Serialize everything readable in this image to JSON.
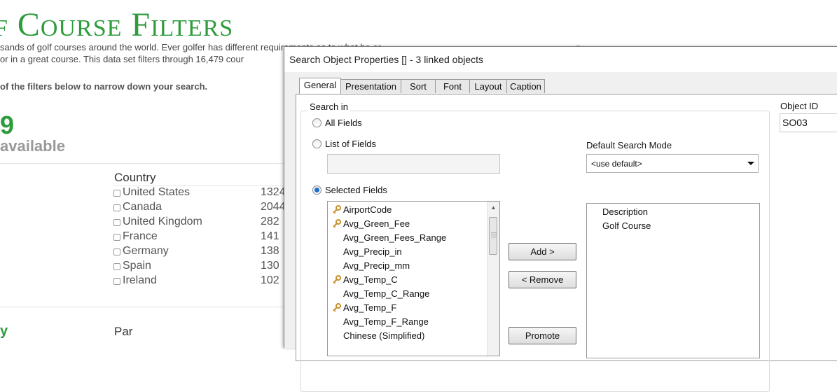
{
  "page": {
    "title": "f Course Filters",
    "intro_lines": [
      "sands of golf courses around the world. Ever golfer has different requirements as to what he or",
      "or in a great course. This data set filters through 16,479 cour"
    ],
    "instruction": " of the filters below to narrow down your search.",
    "count": "9",
    "count_label": "available",
    "country_header": "Country",
    "countries": [
      {
        "name": "United States",
        "count": "1324"
      },
      {
        "name": "Canada",
        "count": "2044"
      },
      {
        "name": "United Kingdom",
        "count": "282"
      },
      {
        "name": "France",
        "count": "141"
      },
      {
        "name": "Germany",
        "count": "138"
      },
      {
        "name": "Spain",
        "count": "130"
      },
      {
        "name": "Ireland",
        "count": "102"
      }
    ],
    "par_header": "Par",
    "left_green_text": "y"
  },
  "dialog": {
    "title": "Search Object Properties [] - 3 linked objects",
    "tabs": [
      "General",
      "Presentation",
      "Sort",
      "Font",
      "Layout",
      "Caption"
    ],
    "active_tab": "General",
    "search_in_label": "Search in",
    "radio_all_fields": "All Fields",
    "radio_list_of_fields": "List of Fields",
    "radio_selected_fields": "Selected Fields",
    "selected_radio": "Selected Fields",
    "list_of_fields_value": "",
    "fields": [
      {
        "name": "AirportCode",
        "key": true
      },
      {
        "name": "Avg_Green_Fee",
        "key": true
      },
      {
        "name": "Avg_Green_Fees_Range",
        "key": false
      },
      {
        "name": "Avg_Precip_in",
        "key": false
      },
      {
        "name": "Avg_Precip_mm",
        "key": false
      },
      {
        "name": "Avg_Temp_C",
        "key": true
      },
      {
        "name": "Avg_Temp_C_Range",
        "key": false
      },
      {
        "name": "Avg_Temp_F",
        "key": true
      },
      {
        "name": "Avg_Temp_F_Range",
        "key": false
      },
      {
        "name": "Chinese (Simplified)",
        "key": false
      }
    ],
    "buttons": {
      "add": "Add >",
      "remove": "< Remove",
      "promote": "Promote"
    },
    "default_search_mode_label": "Default Search Mode",
    "default_search_mode_value": "<use default>",
    "selected_fields": [
      "Description",
      "Golf Course"
    ],
    "object_id_label": "Object ID",
    "object_id_value": "SO03"
  },
  "colors": {
    "brand_green": "#2e9c3c",
    "radio_selected": "#1e6fd0",
    "key_icon": "#c8902a"
  },
  "icons": [
    "search-icon",
    "key-icon",
    "chevron-down-icon",
    "scroll-up-icon"
  ]
}
